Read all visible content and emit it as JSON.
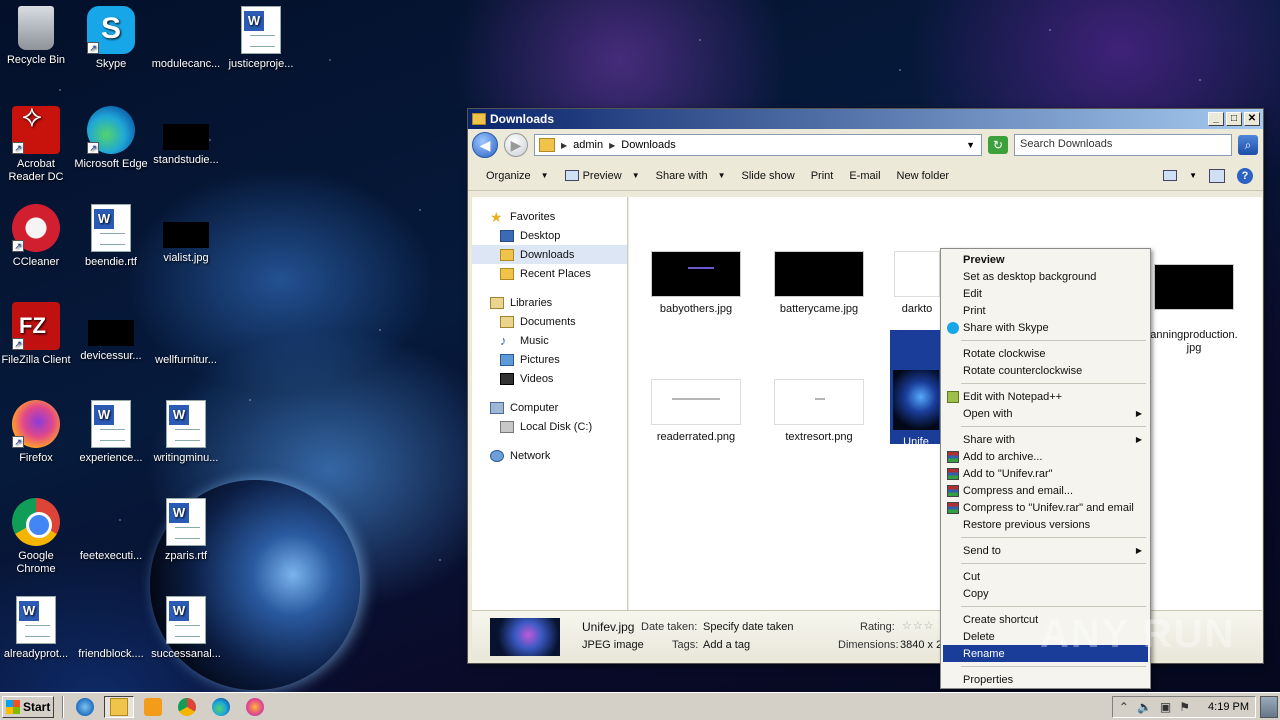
{
  "desktop": {
    "icons": [
      {
        "label": "Recycle Bin",
        "icon": "recycle-bin-icon"
      },
      {
        "label": "Skype",
        "icon": "skype-icon"
      },
      {
        "label": "modulecanc...",
        "icon": "blank-file-icon"
      },
      {
        "label": "justiceproje...",
        "icon": "word-doc-icon"
      },
      {
        "label": "Acrobat\nReader DC",
        "icon": "acrobat-icon"
      },
      {
        "label": "Microsoft Edge",
        "icon": "edge-icon"
      },
      {
        "label": "standstudie...",
        "icon": "black-thumbnail-icon"
      },
      {
        "label": "CCleaner",
        "icon": "ccleaner-icon"
      },
      {
        "label": "beendie.rtf",
        "icon": "word-doc-icon"
      },
      {
        "label": "vialist.jpg",
        "icon": "black-thumbnail-icon"
      },
      {
        "label": "FileZilla Client",
        "icon": "filezilla-icon"
      },
      {
        "label": "devicessur...",
        "icon": "black-thumbnail-icon"
      },
      {
        "label": "wellfurnitur...",
        "icon": "blank-file-icon"
      },
      {
        "label": "Firefox",
        "icon": "firefox-icon"
      },
      {
        "label": "experience...",
        "icon": "word-doc-icon"
      },
      {
        "label": "writingminu...",
        "icon": "word-doc-icon"
      },
      {
        "label": "Google\nChrome",
        "icon": "chrome-icon"
      },
      {
        "label": "feetexecuti...",
        "icon": "blank-file-icon"
      },
      {
        "label": "zparis.rtf",
        "icon": "word-doc-icon"
      },
      {
        "label": "alreadyprot...",
        "icon": "word-doc-icon"
      },
      {
        "label": "friendblock....",
        "icon": "blank-file-icon"
      },
      {
        "label": "successanal...",
        "icon": "word-doc-icon"
      }
    ]
  },
  "window": {
    "title": "Downloads",
    "breadcrumb": [
      "admin",
      "Downloads"
    ],
    "search_placeholder": "Search Downloads",
    "toolbar": {
      "organize": "Organize",
      "preview": "Preview",
      "share_with": "Share with",
      "slide_show": "Slide show",
      "print": "Print",
      "email": "E-mail",
      "new_folder": "New folder"
    },
    "nav": {
      "favorites": "Favorites",
      "desktop": "Desktop",
      "downloads": "Downloads",
      "recent_places": "Recent Places",
      "libraries": "Libraries",
      "documents": "Documents",
      "music": "Music",
      "pictures": "Pictures",
      "videos": "Videos",
      "computer": "Computer",
      "local_disk": "Local Disk (C:)",
      "network": "Network"
    },
    "files": {
      "f1": "babyothers.jpg",
      "f2": "batterycame.jpg",
      "f3": "darkto",
      "f4": "anningproduction.\njpg",
      "f5": "readerrated.png",
      "f6": "textresort.png",
      "f7": "Unife"
    },
    "details": {
      "filename": "Unifev.jpg",
      "type": "JPEG image",
      "date_taken_label": "Date taken:",
      "date_taken_value": "Specify date taken",
      "tags_label": "Tags:",
      "tags_value": "Add a tag",
      "rating_label": "Rating:",
      "dimensions_label": "Dimensions:",
      "dimensions_value": "3840 x 2"
    }
  },
  "context_menu": {
    "preview": "Preview",
    "set_desktop_bg": "Set as desktop background",
    "edit": "Edit",
    "print": "Print",
    "share_skype": "Share with Skype",
    "rotate_cw": "Rotate clockwise",
    "rotate_ccw": "Rotate counterclockwise",
    "edit_npp": "Edit with Notepad++",
    "open_with": "Open with",
    "share_with": "Share with",
    "add_archive": "Add to archive...",
    "add_unifev_rar": "Add to \"Unifev.rar\"",
    "compress_email": "Compress and email...",
    "compress_unifev_email": "Compress to \"Unifev.rar\" and email",
    "restore_versions": "Restore previous versions",
    "send_to": "Send to",
    "cut": "Cut",
    "copy": "Copy",
    "create_shortcut": "Create shortcut",
    "delete": "Delete",
    "rename": "Rename",
    "properties": "Properties"
  },
  "taskbar": {
    "start": "Start",
    "clock": "4:19 PM"
  },
  "watermark": "ANY RUN"
}
